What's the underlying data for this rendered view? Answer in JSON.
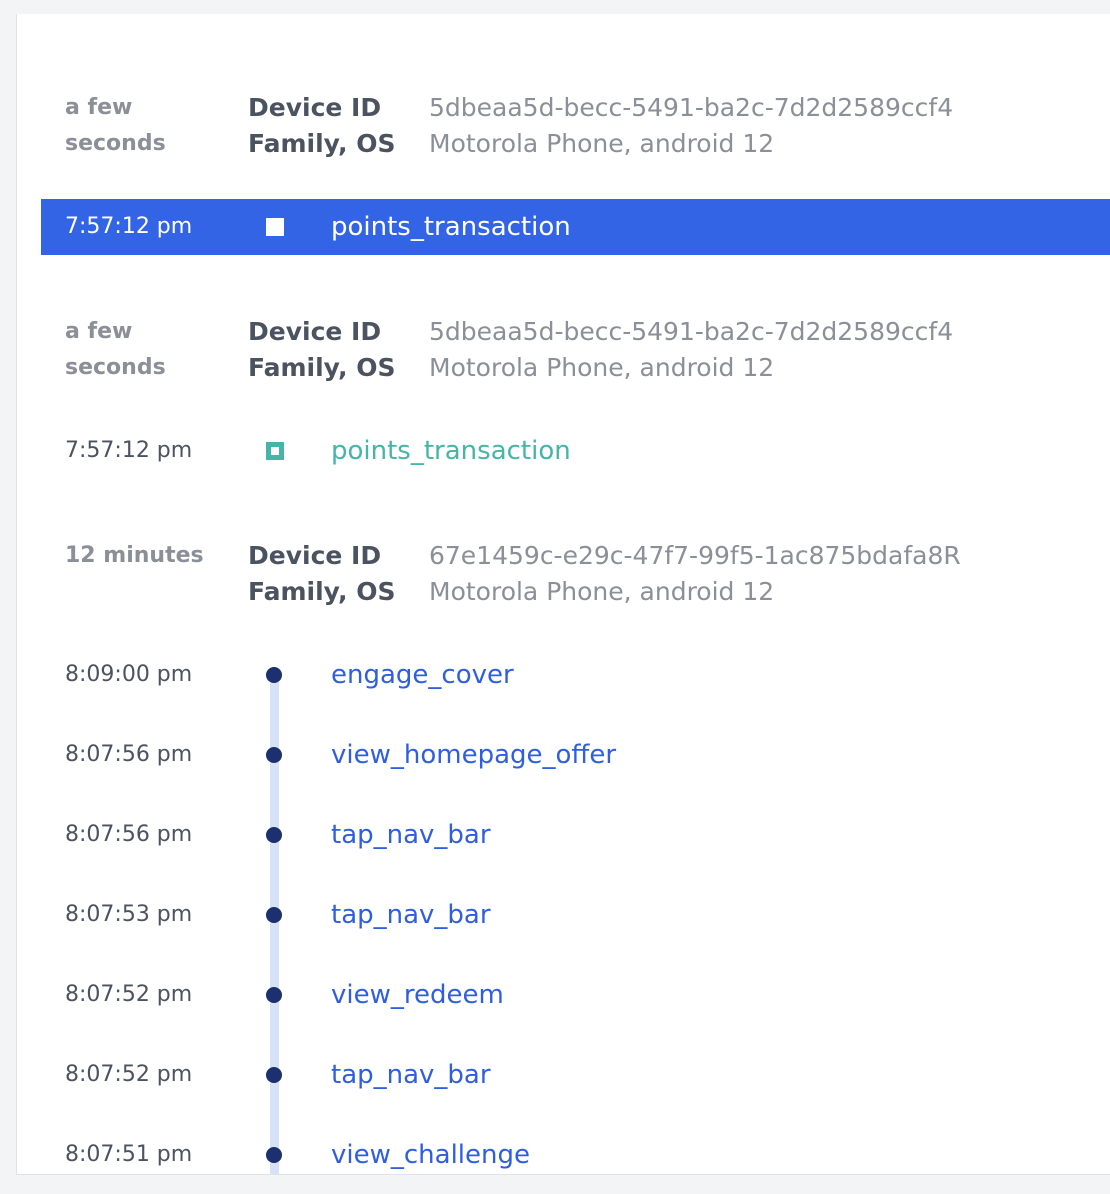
{
  "sessions": [
    {
      "time_lines": [
        "a few",
        "seconds"
      ],
      "keys": [
        "Device ID",
        "Family, OS"
      ],
      "values": [
        "5dbeaa5d-becc-5491-ba2c-7d2d2589ccf4",
        "Motorola Phone, android 12"
      ]
    },
    {
      "time_lines": [
        "a few",
        "seconds"
      ],
      "keys": [
        "Device ID",
        "Family, OS"
      ],
      "values": [
        "5dbeaa5d-becc-5491-ba2c-7d2d2589ccf4",
        "Motorola Phone, android 12"
      ]
    },
    {
      "time_lines": [
        "12 minutes",
        ""
      ],
      "keys": [
        "Device ID",
        "Family, OS"
      ],
      "values": [
        "67e1459c-e29c-47f7-99f5-1ac875bdafa8R",
        "Motorola Phone, android 12"
      ]
    }
  ],
  "selected_event": {
    "time": "7:57:12 pm",
    "name": "points_transaction",
    "icon": "square-icon"
  },
  "teal_event": {
    "time": "7:57:12 pm",
    "name": "points_transaction",
    "icon": "square-icon"
  },
  "timeline_events": [
    {
      "time": "8:09:00 pm",
      "name": "engage_cover"
    },
    {
      "time": "8:07:56 pm",
      "name": "view_homepage_offer"
    },
    {
      "time": "8:07:56 pm",
      "name": "tap_nav_bar"
    },
    {
      "time": "8:07:53 pm",
      "name": "tap_nav_bar"
    },
    {
      "time": "8:07:52 pm",
      "name": "view_redeem"
    },
    {
      "time": "8:07:52 pm",
      "name": "tap_nav_bar"
    },
    {
      "time": "8:07:51 pm",
      "name": "view_challenge"
    }
  ],
  "colors": {
    "selected_bg": "#3464e6",
    "teal": "#45b5a8",
    "link_blue": "#2f5ee0",
    "dot": "#1d2f6e",
    "timeline": "#d6e2f7"
  }
}
